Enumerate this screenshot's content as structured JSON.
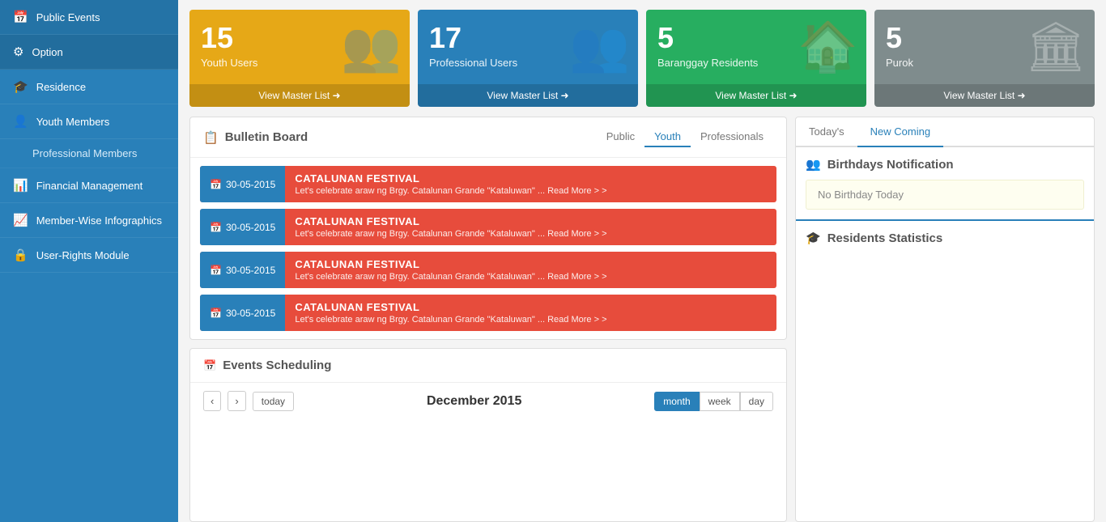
{
  "sidebar": {
    "items": [
      {
        "id": "public-events",
        "label": "Public Events",
        "icon": "📅",
        "active": false
      },
      {
        "id": "option",
        "label": "Option",
        "icon": "⚙",
        "active": true
      },
      {
        "id": "residence",
        "label": "Residence",
        "icon": "🎓",
        "active": false
      },
      {
        "id": "youth-members",
        "label": "Youth Members",
        "icon": "👤",
        "active": false
      },
      {
        "id": "professional-members",
        "label": "Professional Members",
        "icon": "",
        "active": false,
        "sub": true
      },
      {
        "id": "financial-management",
        "label": "Financial Management",
        "icon": "💰",
        "active": false
      },
      {
        "id": "member-wise-infographics",
        "label": "Member-Wise Infographics",
        "icon": "📊",
        "active": false
      },
      {
        "id": "user-rights-module",
        "label": "User-Rights Module",
        "icon": "🔒",
        "active": false
      }
    ]
  },
  "stat_cards": [
    {
      "id": "youth-users",
      "number": "15",
      "label": "Youth Users",
      "view_link": "View Master List ➜",
      "color": "orange",
      "icon": "👥"
    },
    {
      "id": "professional-users",
      "number": "17",
      "label": "Professional Users",
      "view_link": "View Master List ➜",
      "color": "blue",
      "icon": "👥"
    },
    {
      "id": "baranggay-residents",
      "number": "5",
      "label": "Baranggay Residents",
      "view_link": "View Master List ➜",
      "color": "green",
      "icon": "🏠"
    },
    {
      "id": "purok",
      "number": "5",
      "label": "Purok",
      "view_link": "View Master List ➜",
      "color": "gray",
      "icon": "🏛"
    }
  ],
  "bulletin_board": {
    "title": "Bulletin Board",
    "tabs": [
      {
        "id": "public",
        "label": "Public",
        "active": false
      },
      {
        "id": "youth",
        "label": "Youth",
        "active": true
      },
      {
        "id": "professionals",
        "label": "Professionals",
        "active": false
      }
    ],
    "items": [
      {
        "date": "30-05-2015",
        "title": "CATALUNAN FESTIVAL",
        "desc": "Let's celebrate araw ng Brgy. Catalunan Grande \"Kataluwan\" ... Read More > >"
      },
      {
        "date": "30-05-2015",
        "title": "CATALUNAN FESTIVAL",
        "desc": "Let's celebrate araw ng Brgy. Catalunan Grande \"Kataluwan\" ... Read More > >"
      },
      {
        "date": "30-05-2015",
        "title": "CATALUNAN FESTIVAL",
        "desc": "Let's celebrate araw ng Brgy. Catalunan Grande \"Kataluwan\" ... Read More > >"
      },
      {
        "date": "30-05-2015",
        "title": "CATALUNAN FESTIVAL",
        "desc": "Let's celebrate araw ng Brgy. Catalunan Grande \"Kataluwan\" ... Read More > >"
      }
    ]
  },
  "events_scheduling": {
    "title": "Events Scheduling",
    "nav_prev": "‹",
    "nav_next": "›",
    "today_btn": "today",
    "calendar_month": "December 2015",
    "view_buttons": [
      {
        "id": "month",
        "label": "month",
        "active": true
      },
      {
        "id": "week",
        "label": "week",
        "active": false
      },
      {
        "id": "day",
        "label": "day",
        "active": false
      }
    ]
  },
  "right_panel": {
    "tabs": [
      {
        "id": "todays",
        "label": "Today's",
        "active": false
      },
      {
        "id": "new-coming",
        "label": "New Coming",
        "active": true
      }
    ],
    "birthdays_title": "Birthdays Notification",
    "no_birthday_text": "No Birthday Today",
    "residents_stats_title": "Residents Statistics"
  }
}
